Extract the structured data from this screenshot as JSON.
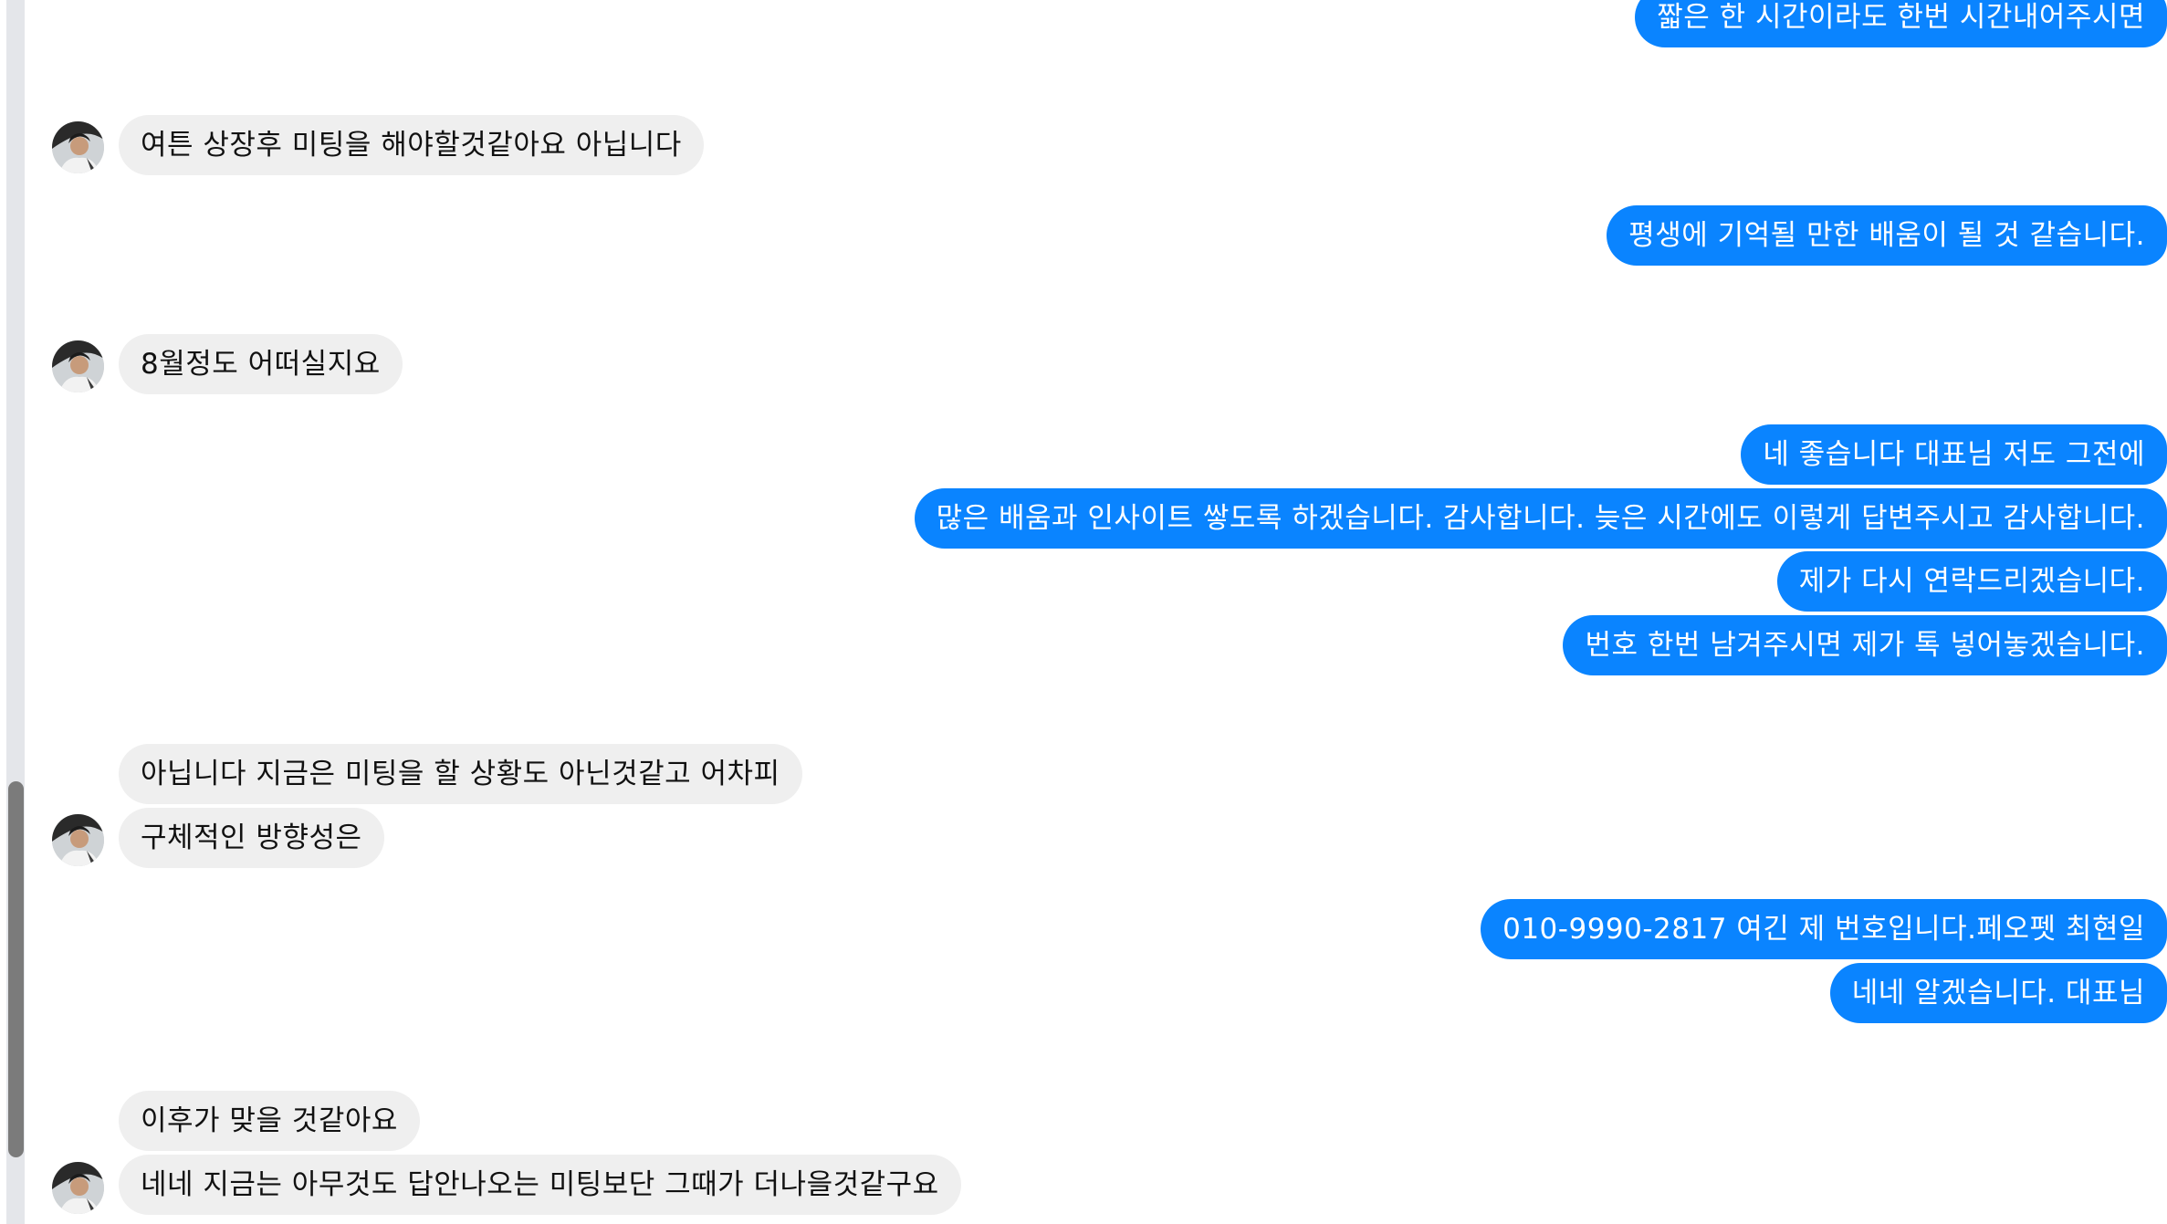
{
  "messages": [
    {
      "side": "out",
      "text": "짧은 한 시간이라도 한번 시간내어주시면"
    },
    {
      "side": "in",
      "text": "여튼 상장후 미팅을 해야할것같아요 아닙니다"
    },
    {
      "side": "out",
      "text": "평생에 기억될 만한 배움이 될 것 같습니다."
    },
    {
      "side": "in",
      "text": "8월정도 어떠실지요"
    },
    {
      "side": "out",
      "text": "네 좋습니다 대표님 저도 그전에"
    },
    {
      "side": "out",
      "text": "많은 배움과 인사이트 쌓도록 하겠습니다. 감사합니다. 늦은 시간에도 이렇게 답변주시고 감사합니다."
    },
    {
      "side": "out",
      "text": "제가 다시 연락드리겠습니다."
    },
    {
      "side": "out",
      "text": "번호 한번 남겨주시면 제가 톡 넣어놓겠습니다."
    },
    {
      "side": "in",
      "text": "아닙니다 지금은 미팅을 할 상황도 아닌것같고 어차피"
    },
    {
      "side": "in",
      "text": "구체적인 방향성은"
    },
    {
      "side": "out",
      "text": "010-9990-2817 여긴 제 번호입니다.페오펫 최현일"
    },
    {
      "side": "out",
      "text": "네네 알겠습니다. 대표님"
    },
    {
      "side": "in",
      "text": "이후가 맞을 것같아요"
    },
    {
      "side": "in",
      "text": "네네 지금는 아무것도 답안나오는 미팅보단 그때가 더나을것같구요"
    }
  ],
  "avatar_icon": "user-avatar-photo",
  "colors": {
    "outgoing_bubble": "#0a84ff",
    "incoming_bubble": "#efefef",
    "scrollbar_thumb": "#7b7b7b"
  }
}
